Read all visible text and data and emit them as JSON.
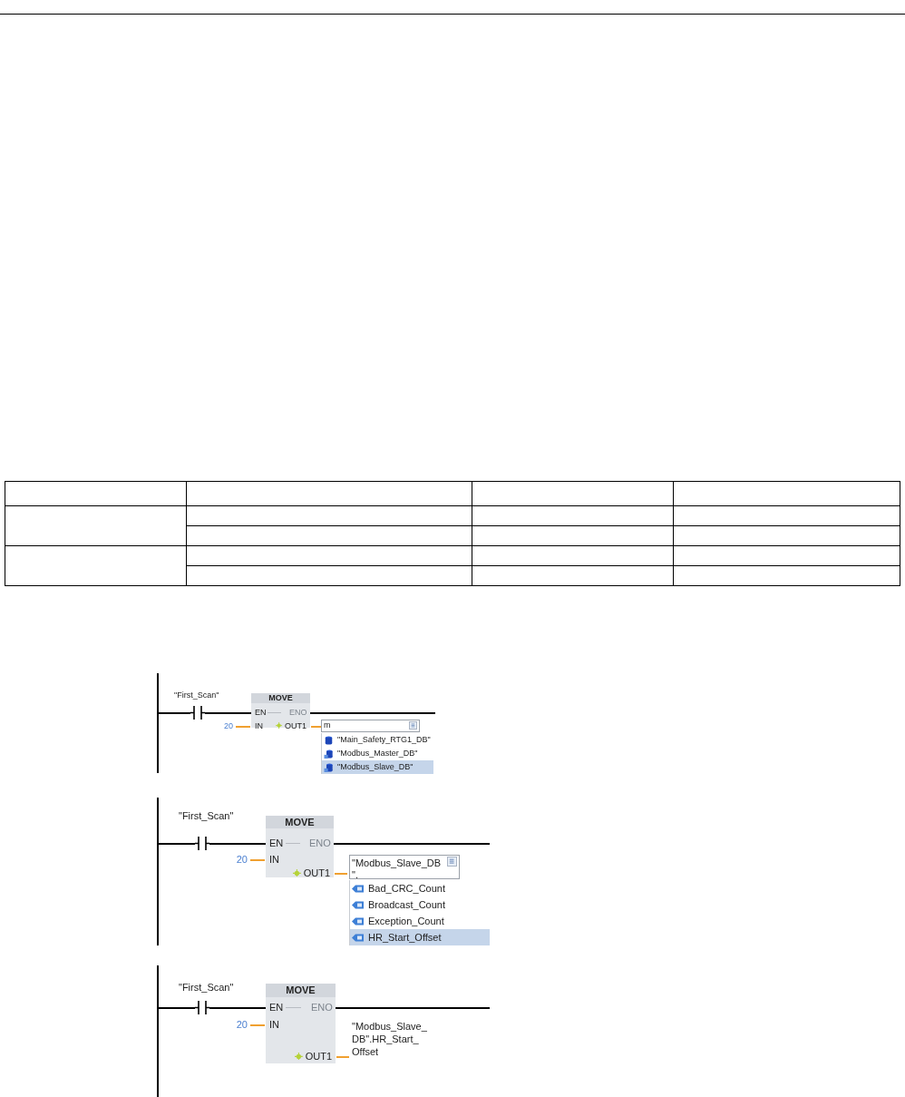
{
  "rungs": [
    {
      "kind": "dropdown",
      "contact": "\"First_Scan\"",
      "block": {
        "title": "MOVE",
        "en": "EN",
        "eno": "ENO",
        "in": "IN",
        "out": "OUT1"
      },
      "in_value": "20",
      "operand_field": {
        "lines": [
          "m"
        ]
      },
      "suggestions": [
        {
          "label": "\"Main_Safety_RTG1_DB\"",
          "kind": "db",
          "selected": false
        },
        {
          "label": "\"Modbus_Master_DB\"",
          "kind": "instance_db",
          "selected": false
        },
        {
          "label": "\"Modbus_Slave_DB\"",
          "kind": "instance_db",
          "selected": true
        }
      ]
    },
    {
      "kind": "dropdown",
      "contact": "\"First_Scan\"",
      "block": {
        "title": "MOVE",
        "en": "EN",
        "eno": "ENO",
        "in": "IN",
        "out": "OUT1"
      },
      "in_value": "20",
      "operand_field": {
        "lines": [
          "\"Modbus_Slave_DB",
          "\"."
        ]
      },
      "suggestions": [
        {
          "label": "Bad_CRC_Count",
          "kind": "member",
          "selected": false
        },
        {
          "label": "Broadcast_Count",
          "kind": "member",
          "selected": false
        },
        {
          "label": "Exception_Count",
          "kind": "member",
          "selected": false
        },
        {
          "label": "HR_Start_Offset",
          "kind": "member",
          "selected": true
        }
      ]
    },
    {
      "kind": "assigned",
      "contact": "\"First_Scan\"",
      "block": {
        "title": "MOVE",
        "en": "EN",
        "eno": "ENO",
        "in": "IN",
        "out": "OUT1"
      },
      "in_value": "20",
      "operand": {
        "lines": [
          "\"Modbus_Slave_",
          "DB\".HR_Start_",
          "Offset"
        ]
      }
    }
  ]
}
